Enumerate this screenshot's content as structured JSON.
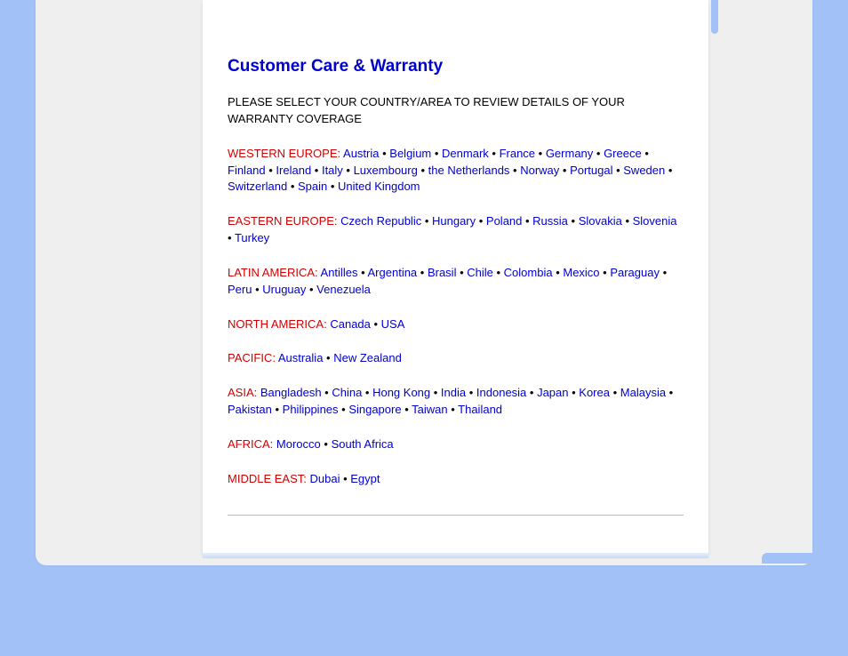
{
  "title": "Customer Care & Warranty",
  "intro": "PLEASE SELECT YOUR COUNTRY/AREA TO REVIEW DETAILS OF YOUR WARRANTY COVERAGE",
  "regions": [
    {
      "label": "WESTERN EUROPE:",
      "countries": [
        "Austria",
        "Belgium",
        "Denmark",
        "France",
        "Germany",
        "Greece",
        "Finland",
        "Ireland",
        "Italy",
        "Luxembourg",
        "the Netherlands",
        "Norway",
        "Portugal",
        "Sweden",
        "Switzerland",
        "Spain",
        "United Kingdom"
      ]
    },
    {
      "label": "EASTERN EUROPE:",
      "countries": [
        "Czech Republic",
        "Hungary",
        "Poland",
        "Russia",
        "Slovakia",
        "Slovenia",
        "Turkey"
      ]
    },
    {
      "label": "LATIN AMERICA:",
      "countries": [
        "Antilles",
        "Argentina",
        "Brasil",
        "Chile",
        "Colombia",
        "Mexico",
        "Paraguay",
        "Peru",
        "Uruguay",
        "Venezuela"
      ]
    },
    {
      "label": "NORTH AMERICA:",
      "countries": [
        "Canada",
        "USA"
      ]
    },
    {
      "label": "PACIFIC:",
      "countries": [
        "Australia",
        "New Zealand"
      ]
    },
    {
      "label": "ASIA:",
      "countries": [
        "Bangladesh",
        "China",
        "Hong Kong",
        "India",
        "Indonesia",
        "Japan",
        "Korea",
        "Malaysia",
        "Pakistan",
        "Philippines",
        "Singapore",
        "Taiwan",
        "Thailand"
      ]
    },
    {
      "label": "AFRICA:",
      "countries": [
        "Morocco",
        "South Africa"
      ]
    },
    {
      "label": "MIDDLE EAST:",
      "countries": [
        "Dubai",
        "Egypt"
      ]
    }
  ]
}
